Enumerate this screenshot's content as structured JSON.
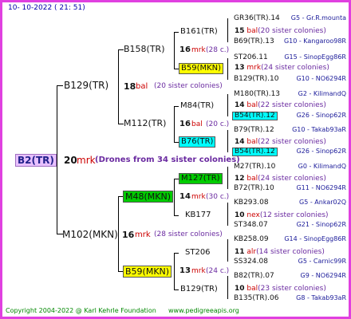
{
  "header": {
    "timestamp": "10- 10-2022 ( 21: 51)"
  },
  "footer": {
    "copyright": "Copyright 2004-2022 @ Karl Kehrle Foundation",
    "website": "www.pedigreeapis.org"
  },
  "colors": {
    "border": "#e040e0",
    "yellow": "#ffff00",
    "cyan": "#00ffff",
    "green": "#00cc00",
    "pink_box": "#e8c0ff",
    "footer_green": "#008800"
  },
  "root": {
    "id": "B2(TR)",
    "num": "20",
    "type": "mrk",
    "note": "(Drones from 34 sister colonies)"
  },
  "gen1": {
    "sire": {
      "id": "B129(TR)",
      "num": "18",
      "type": "bal",
      "note": "(20 sister colonies)"
    },
    "dam": {
      "id": "M102(MKN)",
      "num": "16",
      "type": "mrk",
      "note": "(28 sister colonies)"
    }
  },
  "gen2": {
    "ss": {
      "id": "B158(TR)",
      "num": "16",
      "type": "mrk",
      "note": "(28 c.)"
    },
    "sd": {
      "id": "M112(TR)",
      "num": "16",
      "type": "bal",
      "note": "(20 c.)"
    },
    "ds": {
      "id": "M48(MKN)",
      "num": "14",
      "type": "mrk",
      "note": "(30 c.)"
    },
    "dd": {
      "id": "B59(MKN)",
      "num": "13",
      "type": "mrk",
      "note": "(24 c.)"
    }
  },
  "gen3": {
    "a": {
      "id": "B161(TR)",
      "num": "15",
      "type": "bal",
      "note": "(20 sister colonies)"
    },
    "b": {
      "id": "B59(MKN)",
      "num": "13",
      "type": "mrk",
      "note": "(24 sister colonies)"
    },
    "c": {
      "id": "M84(TR)",
      "num": "14",
      "type": "bal",
      "note": "(22 sister colonies)"
    },
    "d": {
      "id": "B76(TR)",
      "num": "14",
      "type": "bal",
      "note": "(22 sister colonies)"
    },
    "e": {
      "id": "M127(TR)",
      "num": "12",
      "type": "bal",
      "note": "(24 sister colonies)"
    },
    "f": {
      "id": "KB177",
      "num": "10",
      "type": "nex",
      "note": "(12 sister colonies)"
    },
    "g": {
      "id": "ST206",
      "num": "11",
      "type": "alr",
      "note": "(14 sister colonies)"
    },
    "h": {
      "id": "B129(TR)",
      "num": "10",
      "type": "bal",
      "note": "(23 sister colonies)"
    }
  },
  "gen4": [
    {
      "id": "GR36(TR).14",
      "origin": "G5 - Gr.R.mounta"
    },
    {
      "id": "B69(TR).13",
      "origin": "G10 - Kangaroo98R"
    },
    {
      "id": "ST206.11",
      "origin": "G15 - SinopEgg86R"
    },
    {
      "id": "B129(TR).10",
      "origin": "G10 - NO6294R"
    },
    {
      "id": "M180(TR).13",
      "origin": "G2 - KilimandQ"
    },
    {
      "id": "B54(TR).12",
      "origin": "G26 - Sinop62R"
    },
    {
      "id": "B79(TR).12",
      "origin": "G10 - Takab93aR"
    },
    {
      "id": "B54(TR).12",
      "origin": "G26 - Sinop62R"
    },
    {
      "id": "M27(TR).10",
      "origin": "G0 - KilimandQ"
    },
    {
      "id": "B72(TR).10",
      "origin": "G11 - NO6294R"
    },
    {
      "id": "KB293.08",
      "origin": "G5 - Ankar02Q"
    },
    {
      "id": "ST348.07",
      "origin": "G21 - Sinop62R"
    },
    {
      "id": "KB258.09",
      "origin": "G14 - SinopEgg86R"
    },
    {
      "id": "SS324.08",
      "origin": "G5 - Carnic99R"
    },
    {
      "id": "B82(TR).07",
      "origin": "G9 - NO6294R"
    },
    {
      "id": "B135(TR).06",
      "origin": "G8 - Takab93aR"
    }
  ]
}
